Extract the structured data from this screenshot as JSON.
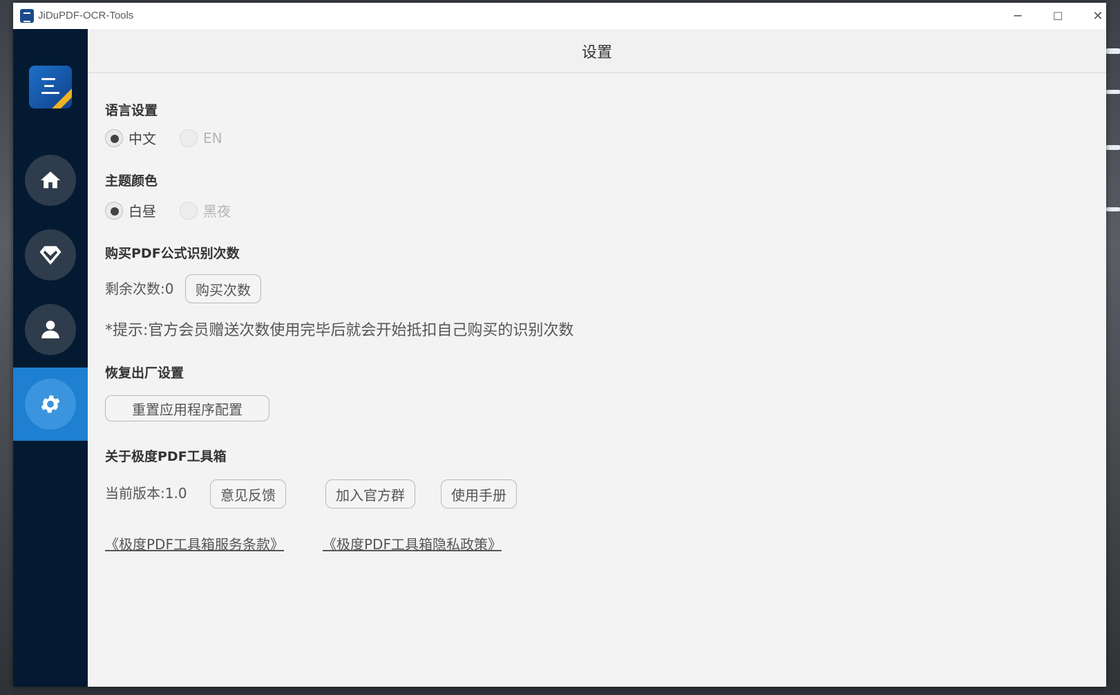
{
  "window": {
    "title": "JiDuPDF-OCR-Tools",
    "controls": {
      "minimize": "─",
      "maximize": "☐",
      "close": "✕"
    }
  },
  "sidebar": {
    "items": [
      {
        "name": "home",
        "icon": "home-icon"
      },
      {
        "name": "vip",
        "icon": "diamond-icon"
      },
      {
        "name": "user",
        "icon": "user-icon"
      },
      {
        "name": "settings",
        "icon": "gear-icon",
        "active": true
      }
    ],
    "active_color": "#1f7fd0",
    "background_color": "#041a33"
  },
  "header": {
    "title": "设置"
  },
  "language": {
    "title": "语言设置",
    "options": [
      {
        "label": "中文",
        "checked": true
      },
      {
        "label": "EN",
        "checked": false
      }
    ]
  },
  "theme": {
    "title": "主题颜色",
    "options": [
      {
        "label": "白昼",
        "checked": true
      },
      {
        "label": "黑夜",
        "checked": false
      }
    ]
  },
  "purchase": {
    "title": "购买PDF公式识别次数",
    "remaining_label": "剩余次数:0",
    "buy_button": "购买次数",
    "tip": "*提示:官方会员赠送次数使用完毕后就会开始抵扣自己购买的识别次数"
  },
  "reset": {
    "title": "恢复出厂设置",
    "button": "重置应用程序配置"
  },
  "about": {
    "title": "关于极度PDF工具箱",
    "version_label": "当前版本:1.0",
    "feedback_button": "意见反馈",
    "join_group_button": "加入官方群",
    "manual_button": "使用手册",
    "terms_link": "《极度PDF工具箱服务条款》",
    "privacy_link": "《极度PDF工具箱隐私政策》"
  }
}
